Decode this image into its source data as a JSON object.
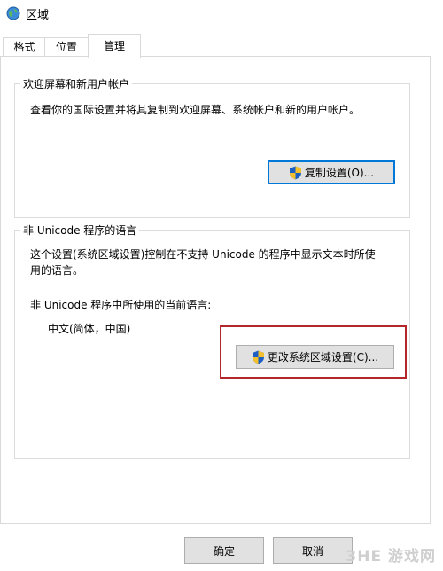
{
  "window": {
    "title": "区域"
  },
  "tabs": [
    {
      "label": "格式"
    },
    {
      "label": "位置"
    },
    {
      "label": "管理",
      "active": true
    }
  ],
  "welcome_group": {
    "legend": "欢迎屏幕和新用户帐户",
    "description": "查看你的国际设置并将其复制到欢迎屏幕、系统帐户和新的用户帐户。",
    "copy_button": "复制设置(O)..."
  },
  "unicode_group": {
    "legend": "非 Unicode 程序的语言",
    "description_line1": "这个设置(系统区域设置)控制在不支持 Unicode 的程序中显示文本时所使",
    "description_line2": "用的语言。",
    "current_label": "非 Unicode 程序中所使用的当前语言:",
    "current_value": "中文(简体，中国)",
    "change_button": "更改系统区域设置(C)..."
  },
  "footer": {
    "ok_button": "确定",
    "cancel_button": "取消"
  },
  "watermark": {
    "text": "3HE 游戏网"
  },
  "colors": {
    "highlight_border": "#b3262a",
    "focus_border": "#0078d7",
    "button_bg": "#e1e1e1"
  }
}
